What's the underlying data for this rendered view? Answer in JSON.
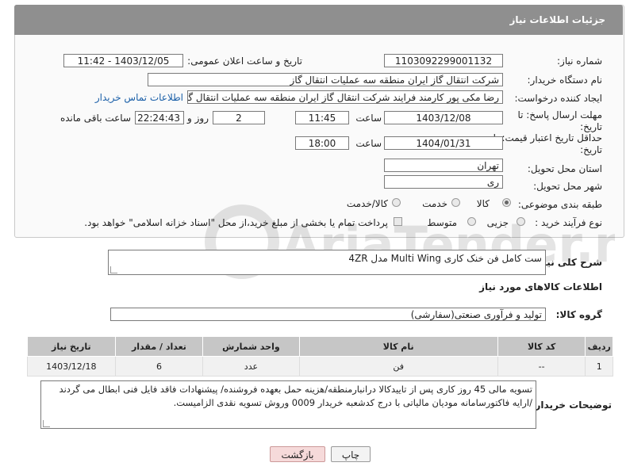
{
  "header": {
    "title": "جزئیات اطلاعات نیاز"
  },
  "fields": {
    "need_number": {
      "label": "شماره نیاز:",
      "value": "1103092299001132"
    },
    "announce_datetime": {
      "label": "تاریخ و ساعت اعلان عمومی:",
      "value": "1403/12/05 - 11:42"
    },
    "buyer_org": {
      "label": "نام دستگاه خریدار:",
      "value": "شرکت انتقال گاز ایران منطقه سه عملیات انتقال گاز"
    },
    "requester": {
      "label": "ایجاد کننده درخواست:",
      "value": "رضا مکی پور کارمند فرایند شرکت انتقال گاز ایران منطقه سه عملیات انتقال گاز",
      "contact_link": "اطلاعات تماس خریدار"
    },
    "reply_deadline": {
      "label_line1": "مهلت ارسال پاسخ: تا",
      "label_line2": "تاریخ:",
      "date": "1403/12/08",
      "time_label": "ساعت",
      "time": "11:45",
      "days": "2",
      "days_label": "روز و",
      "remaining": "22:24:43",
      "remaining_label": "ساعت باقی مانده"
    },
    "price_validity": {
      "label_line1": "حداقل تاریخ اعتبار قیمت: تا",
      "label_line2": "تاریخ:",
      "date": "1404/01/31",
      "time_label": "ساعت",
      "time": "18:00"
    },
    "province": {
      "label": "استان محل تحویل:",
      "value": "تهران"
    },
    "city": {
      "label": "شهر محل تحویل:",
      "value": "ری"
    },
    "category": {
      "label": "طبقه بندی موضوعی:",
      "options": [
        "کالا",
        "خدمت",
        "کالا/خدمت"
      ],
      "selected": "کالا"
    },
    "purchase_type": {
      "label": "نوع فرآیند خرید :",
      "options": [
        "جزیی",
        "متوسط"
      ],
      "payment_note": "پرداخت تمام یا بخشی از مبلغ خرید،از محل \"اسناد خزانه اسلامی\" خواهد بود."
    }
  },
  "description": {
    "label": "شرح کلی نیاز:",
    "value": "ست کامل فن خنک کاری Multi Wing  مدل 4ZR"
  },
  "items_section": {
    "title": "اطلاعات کالاهای مورد نیاز",
    "group_label": "گروه کالا:",
    "group_value": "تولید و فرآوری صنعتی(سفارشی)",
    "columns": [
      "ردیف",
      "کد کالا",
      "نام کالا",
      "واحد شمارش",
      "تعداد / مقدار",
      "تاریخ نیاز"
    ],
    "rows": [
      [
        "1",
        "--",
        "فن",
        "عدد",
        "6",
        "1403/12/18"
      ]
    ]
  },
  "buyer_notes": {
    "label": "توضیحات خریدار:",
    "line1": "تسویه مالی 45 روز کاری پس از تاییدکالا درانبارمنطقه/هزینه حمل بعهده فروشنده/ پیشنهادات فاقد فایل فنی ابطال می گردند",
    "line2": "/ارایه فاکتورسامانه مودیان مالیاتی با درج کدشعبه خریدار 0009 وروش تسویه نقدی الزامیست."
  },
  "buttons": {
    "print": "چاپ",
    "back": "بازگشت"
  },
  "watermark": {
    "text": "AriaTender.net"
  }
}
